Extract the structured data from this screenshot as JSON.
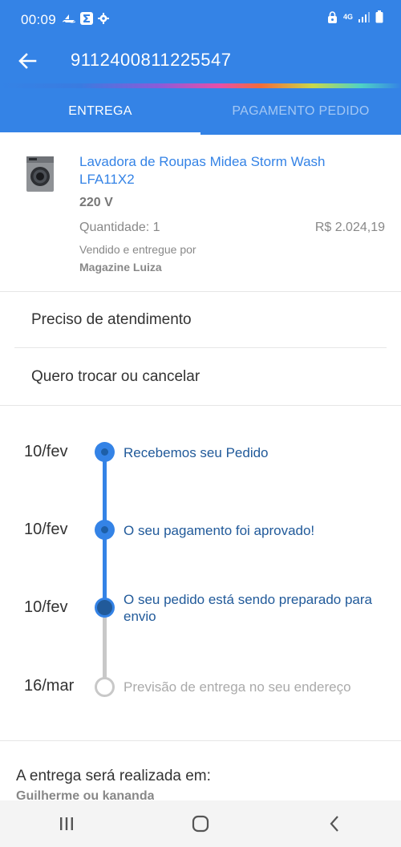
{
  "status_bar": {
    "time": "00:09",
    "network": "4G"
  },
  "header": {
    "order_number": "9112400811225547"
  },
  "tabs": [
    {
      "label": "ENTREGA",
      "active": true
    },
    {
      "label": "PAGAMENTO PEDIDO",
      "active": false
    }
  ],
  "product": {
    "name": "Lavadora de Roupas Midea Storm Wash LFA11X2",
    "variant": "220 V",
    "quantity": "Quantidade: 1",
    "price": "R$ 2.024,19",
    "seller_label": "Vendido e entregue por",
    "seller": "Magazine Luiza"
  },
  "actions": [
    {
      "label": "Preciso de atendimento"
    },
    {
      "label": "Quero trocar ou cancelar"
    }
  ],
  "timeline": [
    {
      "date": "10/fev",
      "text": "Recebemos seu Pedido",
      "state": "done"
    },
    {
      "date": "10/fev",
      "text": "O seu pagamento foi aprovado!",
      "state": "done"
    },
    {
      "date": "10/fev",
      "text": "O seu pedido está sendo preparado para envio",
      "state": "current"
    },
    {
      "date": "16/mar",
      "text": "Previsão de entrega no seu endereço",
      "state": "future"
    }
  ],
  "delivery": {
    "label": "A entrega será realizada em:",
    "recipient": "Guilherme ou kananda"
  },
  "colors": {
    "primary": "#3483e6",
    "timeline_text": "#215a9a",
    "inactive": "#c8c8c8"
  }
}
